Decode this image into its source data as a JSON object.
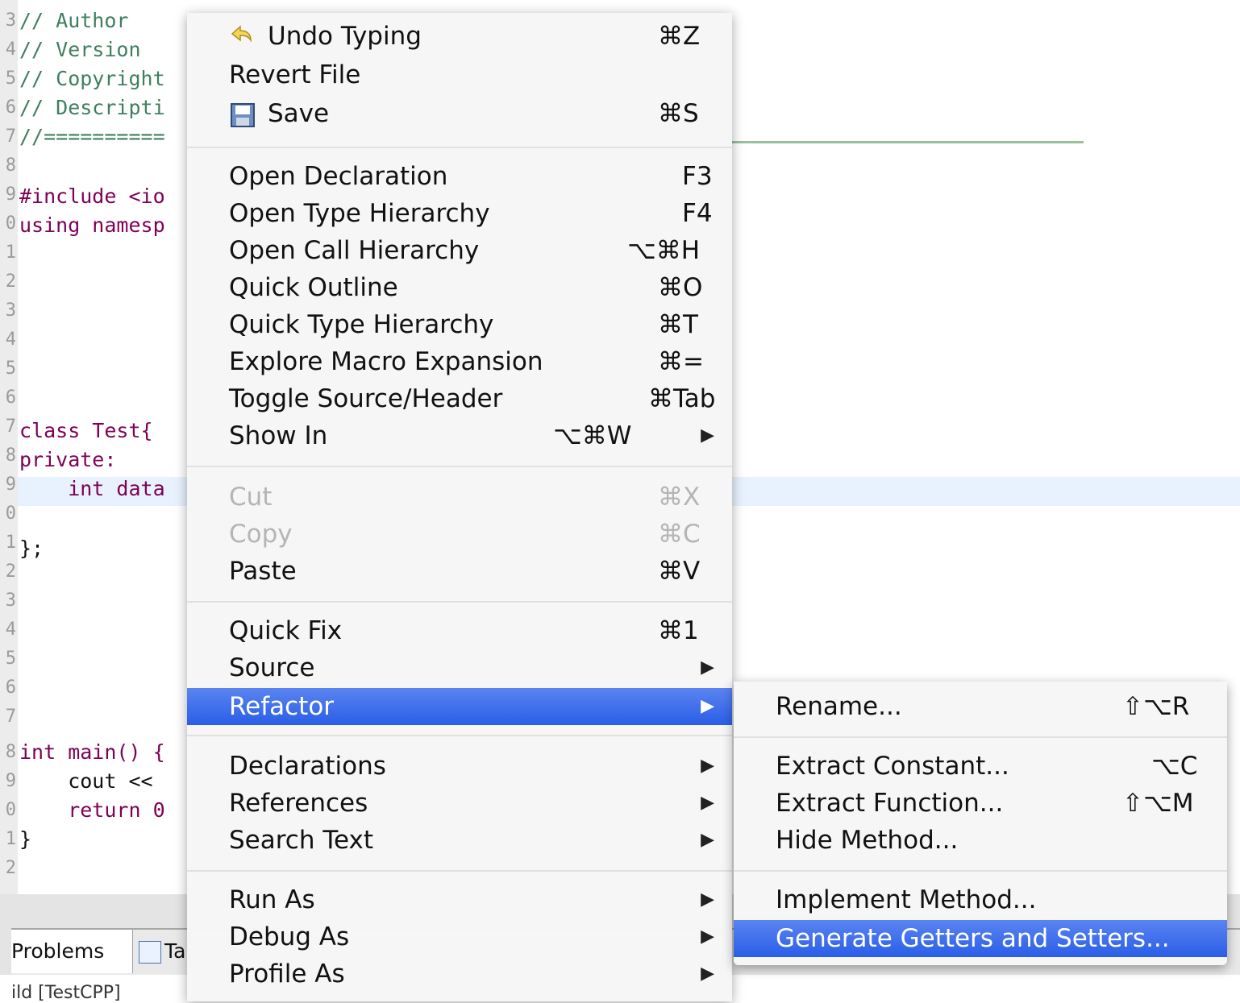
{
  "editor": {
    "line_numbers": [
      "3",
      "4",
      "5",
      "6",
      "7",
      "8",
      "9",
      "0",
      "1",
      "2",
      "3",
      "4",
      "5",
      "6",
      "7",
      "8",
      "9",
      "0",
      "1",
      "2",
      "3",
      "4",
      "5",
      "6",
      "7",
      "8",
      "9",
      "0",
      "1",
      "2"
    ],
    "lines": {
      "author": "// Author",
      "version": "// Version",
      "copyright": "// Copyright",
      "description": "// Descripti",
      "separator": "//==========",
      "include": "#include <io",
      "using": "using namesp",
      "class": "class Test{",
      "private": "private:",
      "int_data": "    int data",
      "close_class": "};",
      "main": "int main() {",
      "cout": "    cout <<",
      "return": "    return 0",
      "close_main": "}"
    }
  },
  "bottom_panel": {
    "tab_problems": "Problems",
    "tab_tasks": "Ta",
    "status_text": "ild [TestCPP]"
  },
  "context_menu": {
    "items": [
      {
        "label": "Undo Typing",
        "shortcut": "⌘Z",
        "icon": "undo-icon"
      },
      {
        "label": "Revert File",
        "shortcut": ""
      },
      {
        "label": "Save",
        "shortcut": "⌘S",
        "icon": "save-icon"
      },
      {
        "label": "Open Declaration",
        "shortcut": "F3"
      },
      {
        "label": "Open Type Hierarchy",
        "shortcut": "F4"
      },
      {
        "label": "Open Call Hierarchy",
        "shortcut": "⌥⌘H"
      },
      {
        "label": "Quick Outline",
        "shortcut": "⌘O"
      },
      {
        "label": "Quick Type Hierarchy",
        "shortcut": "⌘T"
      },
      {
        "label": "Explore Macro Expansion",
        "shortcut": "⌘="
      },
      {
        "label": "Toggle Source/Header",
        "shortcut": "⌘Tab"
      },
      {
        "label": "Show In",
        "shortcut": "⌥⌘W",
        "submenu": true
      },
      {
        "label": "Cut",
        "shortcut": "⌘X",
        "disabled": true
      },
      {
        "label": "Copy",
        "shortcut": "⌘C",
        "disabled": true
      },
      {
        "label": "Paste",
        "shortcut": "⌘V"
      },
      {
        "label": "Quick Fix",
        "shortcut": "⌘1"
      },
      {
        "label": "Source",
        "submenu": true
      },
      {
        "label": "Refactor",
        "submenu": true,
        "selected": true
      },
      {
        "label": "Declarations",
        "submenu": true
      },
      {
        "label": "References",
        "submenu": true
      },
      {
        "label": "Search Text",
        "submenu": true
      },
      {
        "label": "Run As",
        "submenu": true
      },
      {
        "label": "Debug As",
        "submenu": true
      },
      {
        "label": "Profile As",
        "submenu": true
      }
    ],
    "arrow_glyph": "▶"
  },
  "refactor_submenu": {
    "items": [
      {
        "label": "Rename...",
        "shortcut": "⇧⌥R"
      },
      {
        "label": "Extract Constant...",
        "shortcut": "⌥C"
      },
      {
        "label": "Extract Function...",
        "shortcut": "⇧⌥M"
      },
      {
        "label": "Hide Method...",
        "shortcut": ""
      },
      {
        "label": "Implement Method...",
        "shortcut": ""
      },
      {
        "label": "Generate Getters and Setters...",
        "shortcut": "",
        "selected": true
      }
    ]
  },
  "colors": {
    "selection_top": "#5a84f0",
    "selection_bottom": "#2a5ee8",
    "comment": "#3f7f5f",
    "keyword": "#7f0055"
  }
}
